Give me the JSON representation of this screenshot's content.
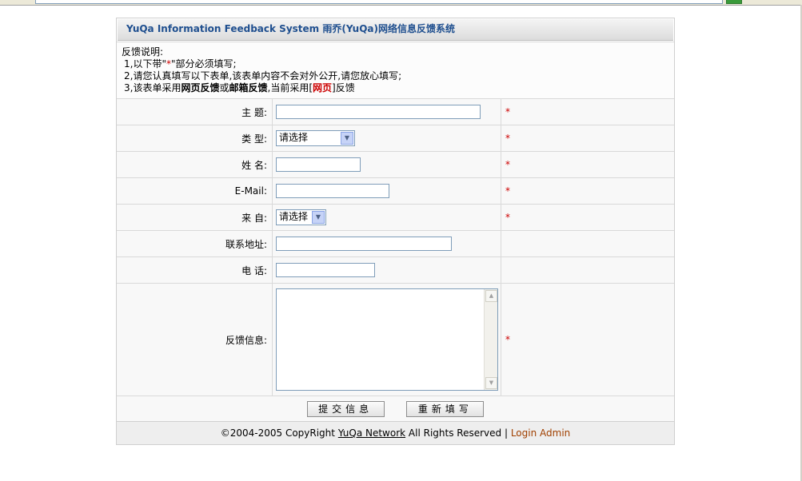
{
  "header": {
    "title": "YuQa Information Feedback System 雨乔(YuQa)网络信息反馈系统"
  },
  "notes": {
    "heading": "反馈说明:",
    "line1_a": "1,以下带\"",
    "line1_star": "*",
    "line1_b": "\"部分必须填写;",
    "line2": "2,请您认真填写以下表单,该表单内容不会对外公开,请您放心填写;",
    "line3_a": "3,该表单采用",
    "line3_web": "网页反馈",
    "line3_or": "或",
    "line3_mail": "邮箱反馈",
    "line3_b": ",当前采用[",
    "line3_current": "网页",
    "line3_c": "]反馈"
  },
  "form": {
    "required_mark": "*",
    "subject_label": "主  题:",
    "type_label": "类  型:",
    "type_value": "请选择",
    "name_label": "姓  名:",
    "email_label": "E-Mail:",
    "from_label": "来  自:",
    "from_value": "请选择",
    "address_label": "联系地址:",
    "phone_label": "电  话:",
    "message_label": "反馈信息:"
  },
  "buttons": {
    "submit": "提交信息",
    "reset": "重新填写"
  },
  "footer": {
    "copyright": "©2004-2005 CopyRight",
    "network": "YuQa Network",
    "rights": "All Rights Reserved |",
    "login": "Login Admin"
  }
}
